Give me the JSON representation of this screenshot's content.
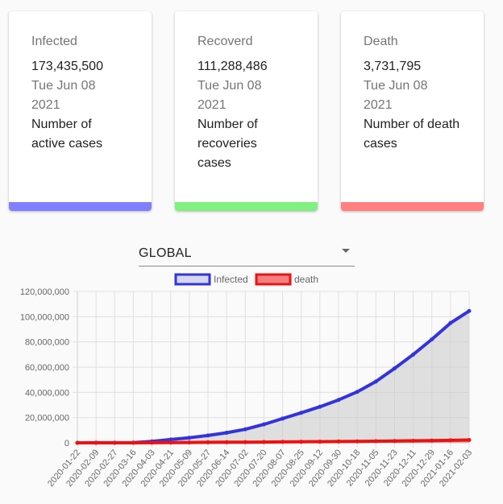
{
  "cards": [
    {
      "title": "Infected",
      "count": "173,435,500",
      "date": "Tue Jun 08 2021",
      "description": "Number of active cases",
      "color": "#8080ff"
    },
    {
      "title": "Recoverd",
      "count": "111,288,486",
      "date": "Tue Jun 08 2021",
      "description": "Number of recoveries cases",
      "color": "#80f080"
    },
    {
      "title": "Death",
      "count": "3,731,795",
      "date": "Tue Jun 08 2021",
      "description": "Number of death cases",
      "color": "#ff8080"
    }
  ],
  "region_select": {
    "value": "GLOBAL"
  },
  "chart_data": {
    "type": "area",
    "x": [
      "2020-01-22",
      "2020-02-09",
      "2020-02-27",
      "2020-03-16",
      "2020-04-03",
      "2020-04-21",
      "2020-05-09",
      "2020-05-27",
      "2020-06-14",
      "2020-07-02",
      "2020-07-20",
      "2020-08-07",
      "2020-08-25",
      "2020-09-12",
      "2020-09-30",
      "2020-10-18",
      "2020-11-05",
      "2020-11-23",
      "2020-12-11",
      "2020-12-29",
      "2021-01-16",
      "2021-02-03"
    ],
    "series": [
      {
        "name": "Infected",
        "color": "#3333dd",
        "fill": "rgba(200,200,200,0.55)",
        "values": [
          600,
          40000,
          84000,
          180000,
          1100000,
          2600000,
          4000000,
          5800000,
          8000000,
          10700000,
          14600000,
          19200000,
          23800000,
          28600000,
          34000000,
          40400000,
          48600000,
          59000000,
          70000000,
          82000000,
          95000000,
          104500000
        ]
      },
      {
        "name": "death",
        "color": "#ee1111",
        "fill": "rgba(230,100,100,0.35)",
        "values": [
          20,
          900,
          2800,
          7000,
          60000,
          180000,
          280000,
          360000,
          440000,
          520000,
          600000,
          700000,
          820000,
          900000,
          1000000,
          1120000,
          1250000,
          1400000,
          1580000,
          1780000,
          2000000,
          2250000
        ]
      }
    ],
    "ylim": [
      0,
      120000000
    ],
    "yticks": [
      "120,000,000",
      "100,000,000",
      "80,000,000",
      "60,000,000",
      "40,000,000",
      "20,000,000",
      "0"
    ],
    "grid": true,
    "legend": "top"
  }
}
